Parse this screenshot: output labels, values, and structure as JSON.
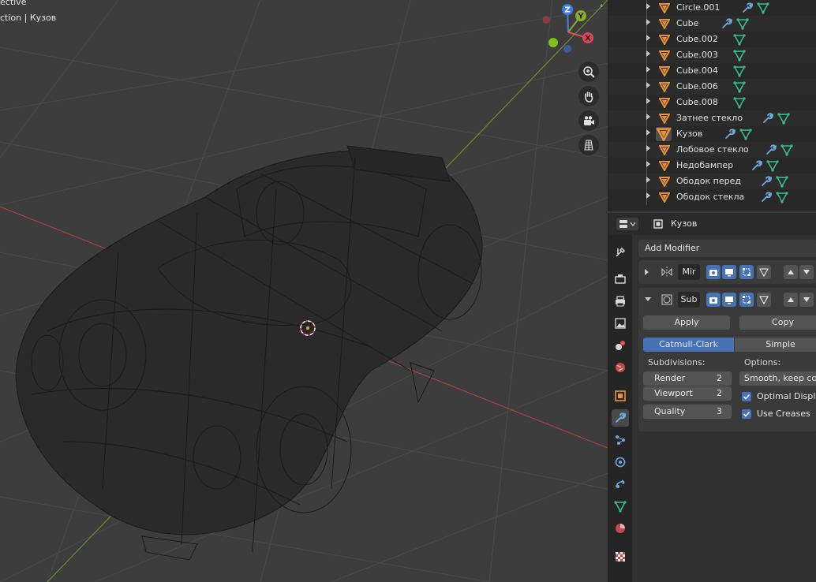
{
  "viewport": {
    "mode_label": "ective",
    "collection_label": "ction | Кузов"
  },
  "gizmo": {
    "z": "Z",
    "y": "Y",
    "x": "X"
  },
  "outliner": {
    "items": [
      {
        "name": "Circle.001"
      },
      {
        "name": "Cube"
      },
      {
        "name": "Cube.002"
      },
      {
        "name": "Cube.003"
      },
      {
        "name": "Cube.004"
      },
      {
        "name": "Cube.006"
      },
      {
        "name": "Cube.008"
      },
      {
        "name": "Затнее стекло"
      },
      {
        "name": "Кузов"
      },
      {
        "name": "Лобовое стекло"
      },
      {
        "name": "Недобампер"
      },
      {
        "name": "Ободок перед"
      },
      {
        "name": "Ободок стекла"
      }
    ]
  },
  "properties": {
    "object_name": "Кузов",
    "add_modifier_label": "Add Modifier",
    "modifiers": [
      {
        "name": "Mir"
      },
      {
        "name": "Sub"
      }
    ],
    "subsurf": {
      "apply_label": "Apply",
      "copy_label": "Copy",
      "algorithms": [
        "Catmull-Clark",
        "Simple"
      ],
      "subdivisions_label": "Subdivisions:",
      "options_label": "Options:",
      "render_label": "Render",
      "render_value": "2",
      "viewport_label": "Viewport",
      "viewport_value": "2",
      "quality_label": "Quality",
      "quality_value": "3",
      "uv_smooth_value": "Smooth, keep cor...",
      "optimal_display_label": "Optimal Displa",
      "use_creases_label": "Use Creases"
    }
  },
  "colors": {
    "accent": "#4772b3",
    "object_icon": "#e8913a",
    "modifier_icon": "#6fa8e0",
    "mesh_icon": "#34c08d",
    "axis_x": "#e04a5d",
    "axis_y": "#89a82a"
  }
}
